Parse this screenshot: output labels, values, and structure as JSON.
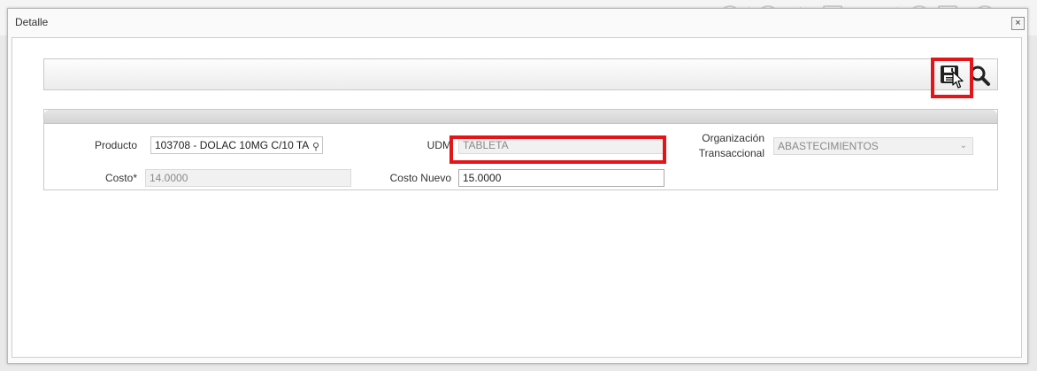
{
  "dialog": {
    "title": "Detalle",
    "close_label": "×"
  },
  "toolbar": {
    "save_icon": "floppy-disk-icon",
    "search_icon": "magnifier-icon"
  },
  "form": {
    "producto_label": "Producto",
    "producto_value": "103708 - DOLAC 10MG C/10 TA",
    "udm_label": "UDM",
    "udm_value": "TABLETA",
    "org_label_line1": "Organización",
    "org_label_line2": "Transaccional",
    "org_value": "ABASTECIMIENTOS",
    "costo_label": "Costo*",
    "costo_value": "14.0000",
    "costo_nuevo_label": "Costo Nuevo",
    "costo_nuevo_value": "15.0000"
  },
  "colors": {
    "highlight": "#e3151b"
  }
}
